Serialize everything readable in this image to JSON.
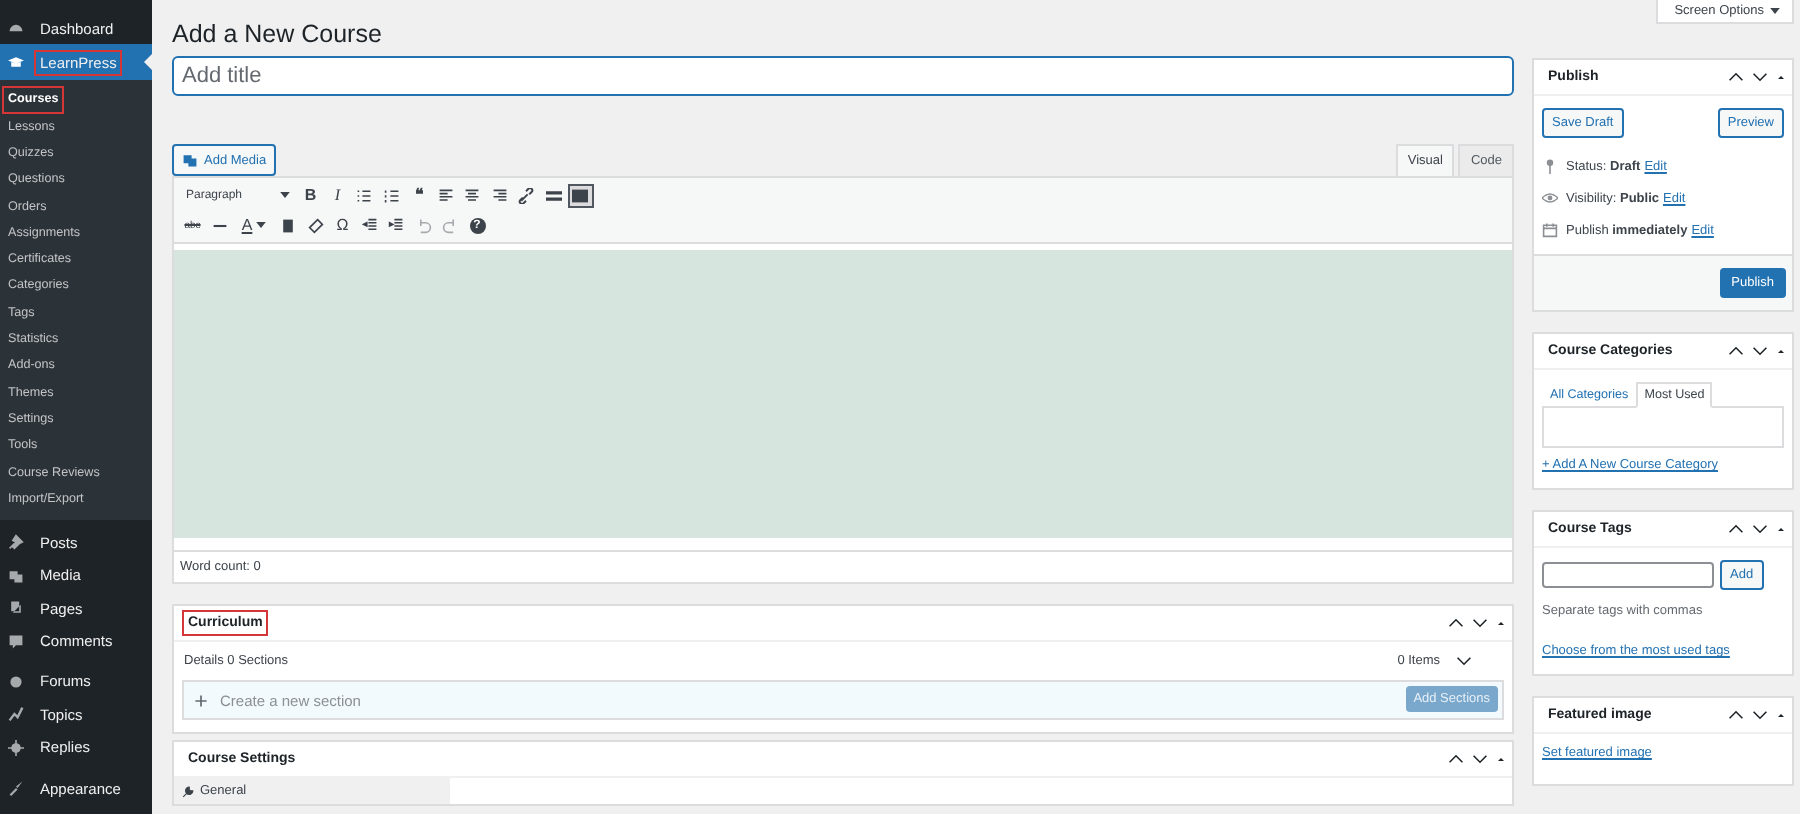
{
  "admin_menu": {
    "top_items": [
      {
        "label": "Dashboard",
        "selected": false,
        "highlighted": false
      },
      {
        "label": "LearnPress",
        "selected": true,
        "highlighted": true
      }
    ],
    "submenu": [
      {
        "label": "Courses",
        "selected": true,
        "highlighted": true
      },
      {
        "label": "Lessons",
        "selected": false,
        "highlighted": false
      },
      {
        "label": "Quizzes",
        "selected": false,
        "highlighted": false
      },
      {
        "label": "Questions",
        "selected": false,
        "highlighted": false
      },
      {
        "label": "Orders",
        "selected": false,
        "highlighted": false
      },
      {
        "label": "Assignments",
        "selected": false,
        "highlighted": false
      },
      {
        "label": "Certificates",
        "selected": false,
        "highlighted": false
      },
      {
        "label": "Categories",
        "selected": false,
        "highlighted": false
      },
      {
        "label": "Tags",
        "selected": false,
        "highlighted": false
      },
      {
        "label": "Statistics",
        "selected": false,
        "highlighted": false
      },
      {
        "label": "Add-ons",
        "selected": false,
        "highlighted": false
      },
      {
        "label": "Themes",
        "selected": false,
        "highlighted": false
      },
      {
        "label": "Settings",
        "selected": false,
        "highlighted": false
      },
      {
        "label": "Tools",
        "selected": false,
        "highlighted": false
      },
      {
        "label": "Course Reviews",
        "selected": false,
        "highlighted": false
      },
      {
        "label": "Import/Export",
        "selected": false,
        "highlighted": false
      }
    ],
    "bottom_groups": [
      [
        {
          "label": "Posts"
        },
        {
          "label": "Media"
        },
        {
          "label": "Pages"
        },
        {
          "label": "Comments"
        }
      ],
      [
        {
          "label": "Forums"
        },
        {
          "label": "Topics"
        },
        {
          "label": "Replies"
        }
      ],
      [
        {
          "label": "Appearance"
        }
      ]
    ]
  },
  "screen_options": "Screen Options",
  "page_title": "Add a New Course",
  "title_field": {
    "placeholder": "Add title"
  },
  "add_media": "Add Media",
  "editor_tabs": [
    {
      "label": "Visual",
      "selected": true
    },
    {
      "label": "Code",
      "selected": false
    }
  ],
  "toolbar_rows": [
    [
      {
        "kind": "select",
        "label": "Paragraph"
      },
      {
        "kind": "glyph",
        "label": "B"
      },
      {
        "kind": "glyph",
        "label": "I"
      },
      {
        "kind": "icon"
      },
      {
        "kind": "icon"
      },
      {
        "kind": "glyph",
        "label": "❝"
      },
      {
        "kind": "icon"
      },
      {
        "kind": "icon"
      },
      {
        "kind": "icon"
      },
      {
        "kind": "icon"
      },
      {
        "kind": "icon"
      },
      {
        "kind": "icon",
        "pressed": true
      }
    ],
    [
      {
        "kind": "glyph",
        "label": "abc"
      },
      {
        "kind": "icon"
      },
      {
        "kind": "color",
        "label": "A"
      },
      {
        "kind": "icon"
      },
      {
        "kind": "icon"
      },
      {
        "kind": "glyph",
        "label": "Ω"
      },
      {
        "kind": "icon"
      },
      {
        "kind": "icon"
      },
      {
        "kind": "icon",
        "disabled": true
      },
      {
        "kind": "icon",
        "disabled": true
      },
      {
        "kind": "glyph",
        "label": "?"
      }
    ]
  ],
  "word_count": "Word count: 0",
  "curriculum": {
    "title": "Curriculum",
    "highlighted": true,
    "details": "Details 0 Sections",
    "items": "0 Items",
    "new_section": {
      "placeholder": "Create a new section"
    },
    "add_button": "Add Sections"
  },
  "course_settings": {
    "title": "Course Settings",
    "tabs": [
      {
        "label": "General",
        "selected": true
      }
    ]
  },
  "publish": {
    "title": "Publish",
    "save_draft": "Save Draft",
    "preview": "Preview",
    "status_label": "Status:",
    "status": "Draft",
    "visibility_label": "Visibility:",
    "visibility": "Public",
    "publish_label": "Publish",
    "publish_when": "immediately",
    "status_edit": "Edit",
    "visibility_edit": "Edit",
    "publish_edit": "Edit",
    "publish_button": "Publish"
  },
  "categories": {
    "title": "Course Categories",
    "tabs": [
      {
        "label": "All Categories",
        "selected": false
      },
      {
        "label": "Most Used",
        "selected": true
      }
    ],
    "add_link": "+ Add A New Course Category"
  },
  "tags": {
    "title": "Course Tags",
    "add": "Add",
    "hint": "Separate tags with commas",
    "choose_link": "Choose from the most used tags"
  },
  "featured": {
    "title": "Featured image",
    "link": "Set featured image"
  }
}
